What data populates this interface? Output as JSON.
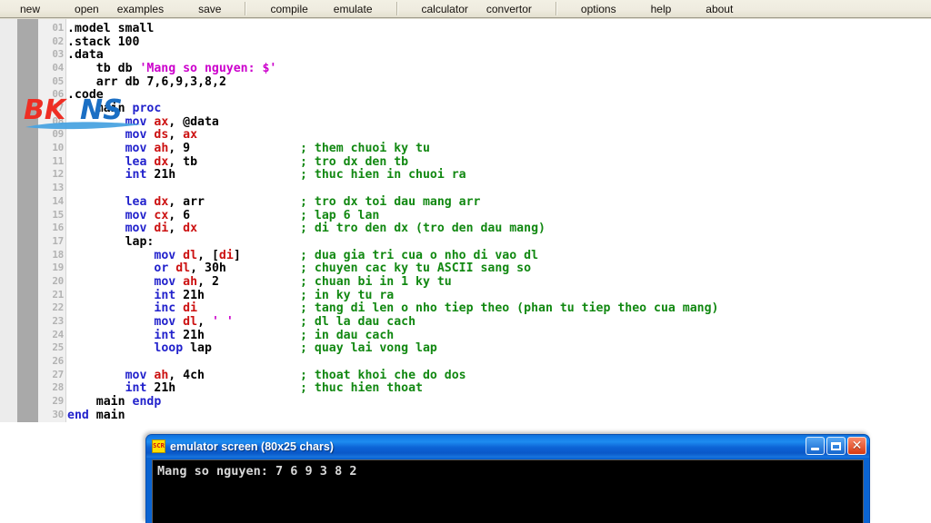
{
  "toolbar": {
    "groups": [
      {
        "items": [
          "new",
          "open",
          "examples",
          "save"
        ]
      },
      {
        "items": [
          "compile",
          "emulate"
        ]
      },
      {
        "items": [
          "calculator",
          "convertor"
        ]
      },
      {
        "items": [
          "options",
          "help",
          "about"
        ]
      }
    ]
  },
  "editor": {
    "line_numbers": [
      "01",
      "02",
      "03",
      "04",
      "05",
      "06",
      "07",
      "08",
      "09",
      "10",
      "11",
      "12",
      "13",
      "14",
      "15",
      "16",
      "17",
      "18",
      "19",
      "20",
      "21",
      "22",
      "23",
      "24",
      "25",
      "26",
      "27",
      "28",
      "29",
      "30"
    ],
    "lines": [
      {
        "n": "01",
        "indent": 0,
        "code": ".model small",
        "comment": ""
      },
      {
        "n": "02",
        "indent": 0,
        "code": ".stack 100",
        "comment": ""
      },
      {
        "n": "03",
        "indent": 0,
        "code": ".data",
        "comment": ""
      },
      {
        "n": "04",
        "indent": 4,
        "code": "tb db 'Mang so nguyen: $'",
        "comment": ""
      },
      {
        "n": "05",
        "indent": 4,
        "code": "arr db 7,6,9,3,8,2",
        "comment": ""
      },
      {
        "n": "06",
        "indent": 0,
        "code": ".code",
        "comment": ""
      },
      {
        "n": "07",
        "indent": 4,
        "code": "main proc",
        "comment": ""
      },
      {
        "n": "08",
        "indent": 8,
        "code": "mov ax, @data",
        "comment": ""
      },
      {
        "n": "09",
        "indent": 8,
        "code": "mov ds, ax",
        "comment": ""
      },
      {
        "n": "10",
        "indent": 8,
        "code": "mov ah, 9",
        "comment": "; them chuoi ky tu"
      },
      {
        "n": "11",
        "indent": 8,
        "code": "lea dx, tb",
        "comment": "; tro dx den tb"
      },
      {
        "n": "12",
        "indent": 8,
        "code": "int 21h",
        "comment": "; thuc hien in chuoi ra"
      },
      {
        "n": "13",
        "indent": 0,
        "code": "",
        "comment": ""
      },
      {
        "n": "14",
        "indent": 8,
        "code": "lea dx, arr",
        "comment": "; tro dx toi dau mang arr"
      },
      {
        "n": "15",
        "indent": 8,
        "code": "mov cx, 6",
        "comment": "; lap 6 lan"
      },
      {
        "n": "16",
        "indent": 8,
        "code": "mov di, dx",
        "comment": "; di tro den dx (tro den dau mang)"
      },
      {
        "n": "17",
        "indent": 8,
        "code": "lap:",
        "comment": ""
      },
      {
        "n": "18",
        "indent": 12,
        "code": "mov dl, [di]",
        "comment": "; dua gia tri cua o nho di vao dl"
      },
      {
        "n": "19",
        "indent": 12,
        "code": "or dl, 30h",
        "comment": "; chuyen cac ky tu ASCII sang so"
      },
      {
        "n": "20",
        "indent": 12,
        "code": "mov ah, 2",
        "comment": "; chuan bi in 1 ky tu"
      },
      {
        "n": "21",
        "indent": 12,
        "code": "int 21h",
        "comment": "; in ky tu ra"
      },
      {
        "n": "22",
        "indent": 12,
        "code": "inc di",
        "comment": "; tang di len o nho tiep theo (phan tu tiep theo cua mang)"
      },
      {
        "n": "23",
        "indent": 12,
        "code": "mov dl, ' '",
        "comment": "; dl la dau cach"
      },
      {
        "n": "24",
        "indent": 12,
        "code": "int 21h",
        "comment": "; in dau cach"
      },
      {
        "n": "25",
        "indent": 12,
        "code": "loop lap",
        "comment": "; quay lai vong lap"
      },
      {
        "n": "26",
        "indent": 0,
        "code": "",
        "comment": ""
      },
      {
        "n": "27",
        "indent": 8,
        "code": "mov ah, 4ch",
        "comment": "; thoat khoi che do dos"
      },
      {
        "n": "28",
        "indent": 8,
        "code": "int 21h",
        "comment": "; thuc hien thoat"
      },
      {
        "n": "29",
        "indent": 4,
        "code": "main endp",
        "comment": ""
      },
      {
        "n": "30",
        "indent": 0,
        "code": "end main",
        "comment": ""
      }
    ]
  },
  "watermark": {
    "text_bk": "BK",
    "text_ns": "NS",
    "color_bk": "#ee2e24",
    "color_ns": "#1b6fc4",
    "color_swoosh": "#4aa3e0"
  },
  "emulator": {
    "title": "emulator screen (80x25 chars)",
    "icon_label": "SCR",
    "controls": {
      "minimize": "minimize",
      "maximize": "maximize",
      "close": "✕"
    },
    "screen_lines": [
      "Mang so nguyen: 7 6 9 3 8 2"
    ]
  },
  "colors": {
    "mnemonic": "#2222cc",
    "register": "#cc1111",
    "comment": "#118811",
    "string": "#cc00cc",
    "titlebar": "#0f6fd8",
    "toolbar_bg": "#efece0"
  }
}
